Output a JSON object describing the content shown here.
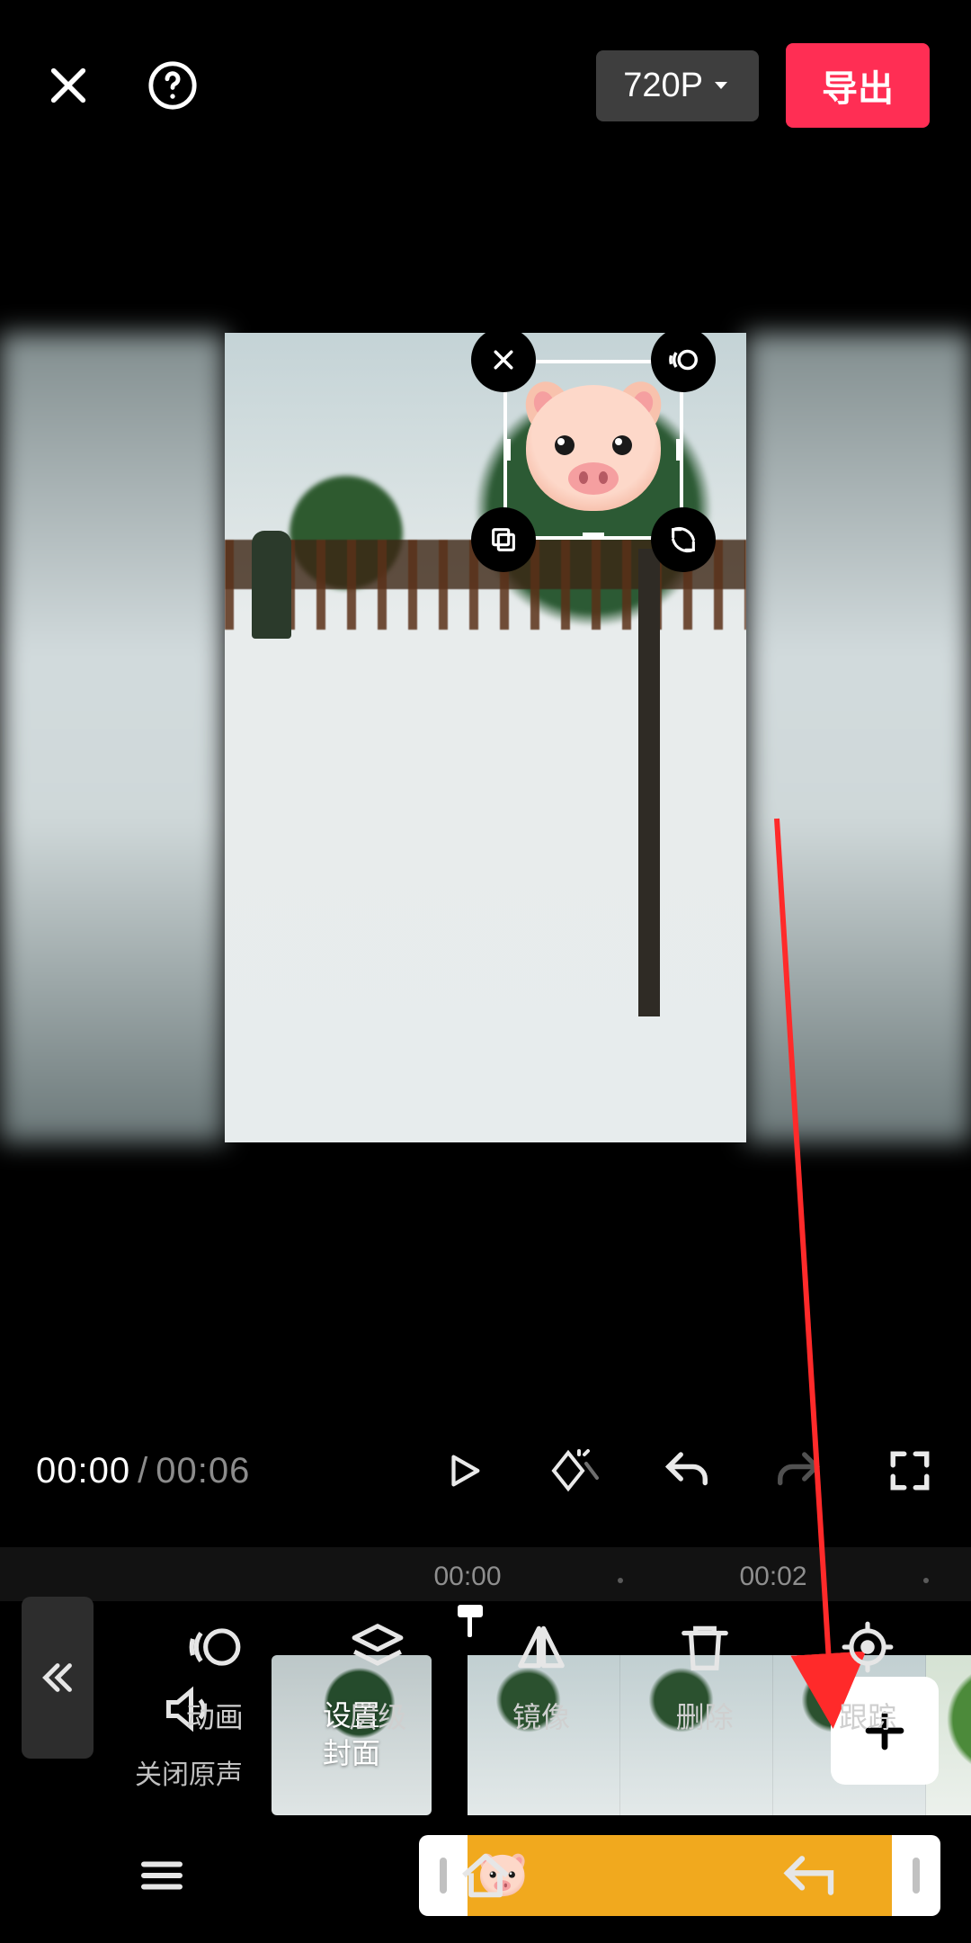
{
  "header": {
    "resolution_label": "720P",
    "export_label": "导出"
  },
  "playback": {
    "current_time": "00:00",
    "separator": "/",
    "total_time": "00:06"
  },
  "timeline": {
    "ruler_marks": {
      "t0": "00:00",
      "t2": "00:02"
    },
    "mute_label": "关闭原声",
    "cover_label": "设置\n封面"
  },
  "tools": {
    "animation": "动画",
    "layer": "层级",
    "mirror": "镜像",
    "delete": "删除",
    "track": "跟踪"
  },
  "icons": {
    "close": "close-icon",
    "help": "help-icon",
    "chevron_down": "chevron-down-icon",
    "sel_delete": "close-icon",
    "sel_motion": "motion-icon",
    "sel_copy": "copy-icon",
    "sel_rotate": "rotate-icon",
    "play": "play-icon",
    "keyframe": "keyframe-icon",
    "undo": "undo-icon",
    "redo": "redo-icon",
    "fullscreen": "fullscreen-icon",
    "speaker": "speaker-icon",
    "plus": "plus-icon",
    "back": "chevrons-left-icon",
    "tool_animation": "animation-icon",
    "tool_layer": "layers-icon",
    "tool_mirror": "mirror-icon",
    "tool_delete": "trash-icon",
    "tool_track": "target-icon",
    "nav_menu": "menu-icon",
    "nav_home": "home-icon",
    "nav_back": "back-icon"
  }
}
